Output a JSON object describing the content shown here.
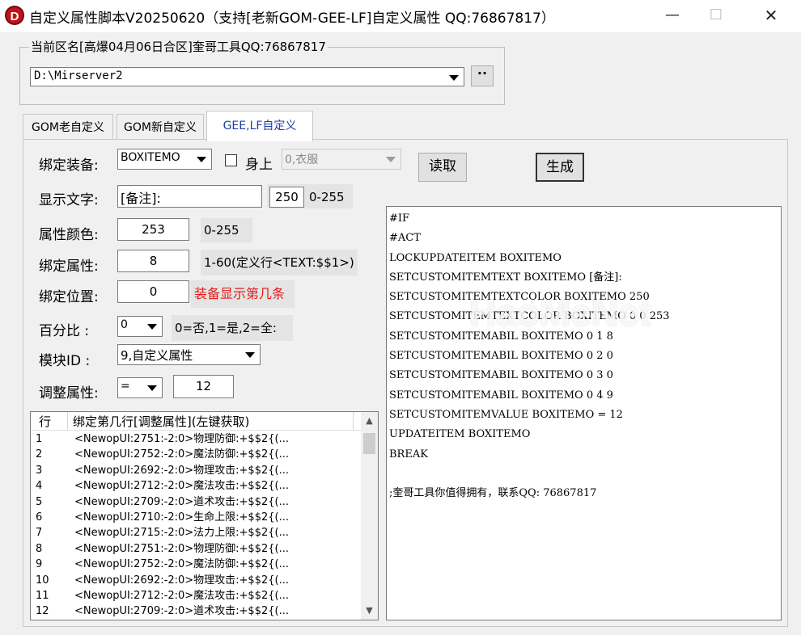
{
  "window": {
    "title": "自定义属性脚本V20250620（支持[老新GOM-GEE-LF]自定义属性 QQ:76867817）",
    "icon_letter": "D",
    "minimize": "—",
    "maximize": "☐",
    "close": "✕"
  },
  "region_group": {
    "legend": "当前区名[高爆04月06日合区]奎哥工具QQ:76867817",
    "path_value": "D:\\Mirserver2",
    "browse_label": "··"
  },
  "tabs": [
    "GOM老自定义",
    "GOM新自定义",
    "GEE,LF自定义"
  ],
  "active_tab": "GEE,LF自定义",
  "form": {
    "bind_equip_label": "绑定装备:",
    "bind_equip_value": "BOXITEMO",
    "on_body_checkbox_label": "身上",
    "on_body_checked": false,
    "body_slot_value": "0,衣服",
    "read_button": "读取",
    "generate_button": "生成",
    "display_text_label": "显示文字:",
    "display_text_value": "[备注]:",
    "display_text_color": "250",
    "display_text_range": "0-255",
    "attr_color_label": "属性颜色:",
    "attr_color_value": "253",
    "attr_color_range": "0-255",
    "bind_attr_label": "绑定属性:",
    "bind_attr_value": "8",
    "bind_attr_hint": "1-60(定义行<TEXT:$$1>)",
    "bind_pos_label": "绑定位置:",
    "bind_pos_value": "0",
    "bind_pos_hint": "装备显示第几条",
    "percent_label": "百分比  :",
    "percent_value": "0",
    "percent_hint": "0=否,1=是,2=全:",
    "module_label": "模块ID  :",
    "module_value": "9,自定义属性",
    "adjust_label": "调整属性:",
    "adjust_op": "=",
    "adjust_value": "12"
  },
  "colors": {
    "hint_red": "#e31b1b",
    "tab_active_text": "#1a3fa6",
    "icon_red": "#c0141a"
  },
  "code_lines": [
    "#IF",
    "#ACT",
    "LOCKUPDATEITEM BOXITEMO",
    "SETCUSTOMITEMTEXT BOXITEMO [备注]:",
    "SETCUSTOMITEMTEXTCOLOR BOXITEMO 250",
    "SETCUSTOMITEMTEXTCOLOR BOXITEMO 0 0 253",
    "SETCUSTOMITEMABIL BOXITEMO 0 1 8",
    "SETCUSTOMITEMABIL BOXITEMO 0 2 0",
    "SETCUSTOMITEMABIL BOXITEMO 0 3 0",
    "SETCUSTOMITEMABIL BOXITEMO 0 4 9",
    "SETCUSTOMITEMVALUE BOXITEMO = 12",
    "UPDATEITEM BOXITEMO",
    "BREAK",
    "",
    ";奎哥工具你值得拥有，联系QQ: 76867817"
  ],
  "watermark": "HaoMeNet",
  "list": {
    "columns": [
      "行",
      "绑定第几行[调整属性](左键获取)"
    ],
    "rows": [
      {
        "n": "1",
        "text": "<NewopUI:2751:-2:0>物理防御:+$$2{(..."
      },
      {
        "n": "2",
        "text": "<NewopUI:2752:-2:0>魔法防御:+$$2{(..."
      },
      {
        "n": "3",
        "text": "<NewopUI:2692:-2:0>物理攻击:+$$2{(..."
      },
      {
        "n": "4",
        "text": "<NewopUI:2712:-2:0>魔法攻击:+$$2{(..."
      },
      {
        "n": "5",
        "text": "<NewopUI:2709:-2:0>道术攻击:+$$2{(..."
      },
      {
        "n": "6",
        "text": "<NewopUI:2710:-2:0>生命上限:+$$2{(..."
      },
      {
        "n": "7",
        "text": "<NewopUI:2715:-2:0>法力上限:+$$2{(..."
      },
      {
        "n": "8",
        "text": "<NewopUI:2751:-2:0>物理防御:+$$2{(..."
      },
      {
        "n": "9",
        "text": "<NewopUI:2752:-2:0>魔法防御:+$$2{(..."
      },
      {
        "n": "10",
        "text": "<NewopUI:2692:-2:0>物理攻击:+$$2{(..."
      },
      {
        "n": "11",
        "text": "<NewopUI:2712:-2:0>魔法攻击:+$$2{(..."
      },
      {
        "n": "12",
        "text": "<NewopUI:2709:-2:0>道术攻击:+$$2{(..."
      }
    ]
  }
}
